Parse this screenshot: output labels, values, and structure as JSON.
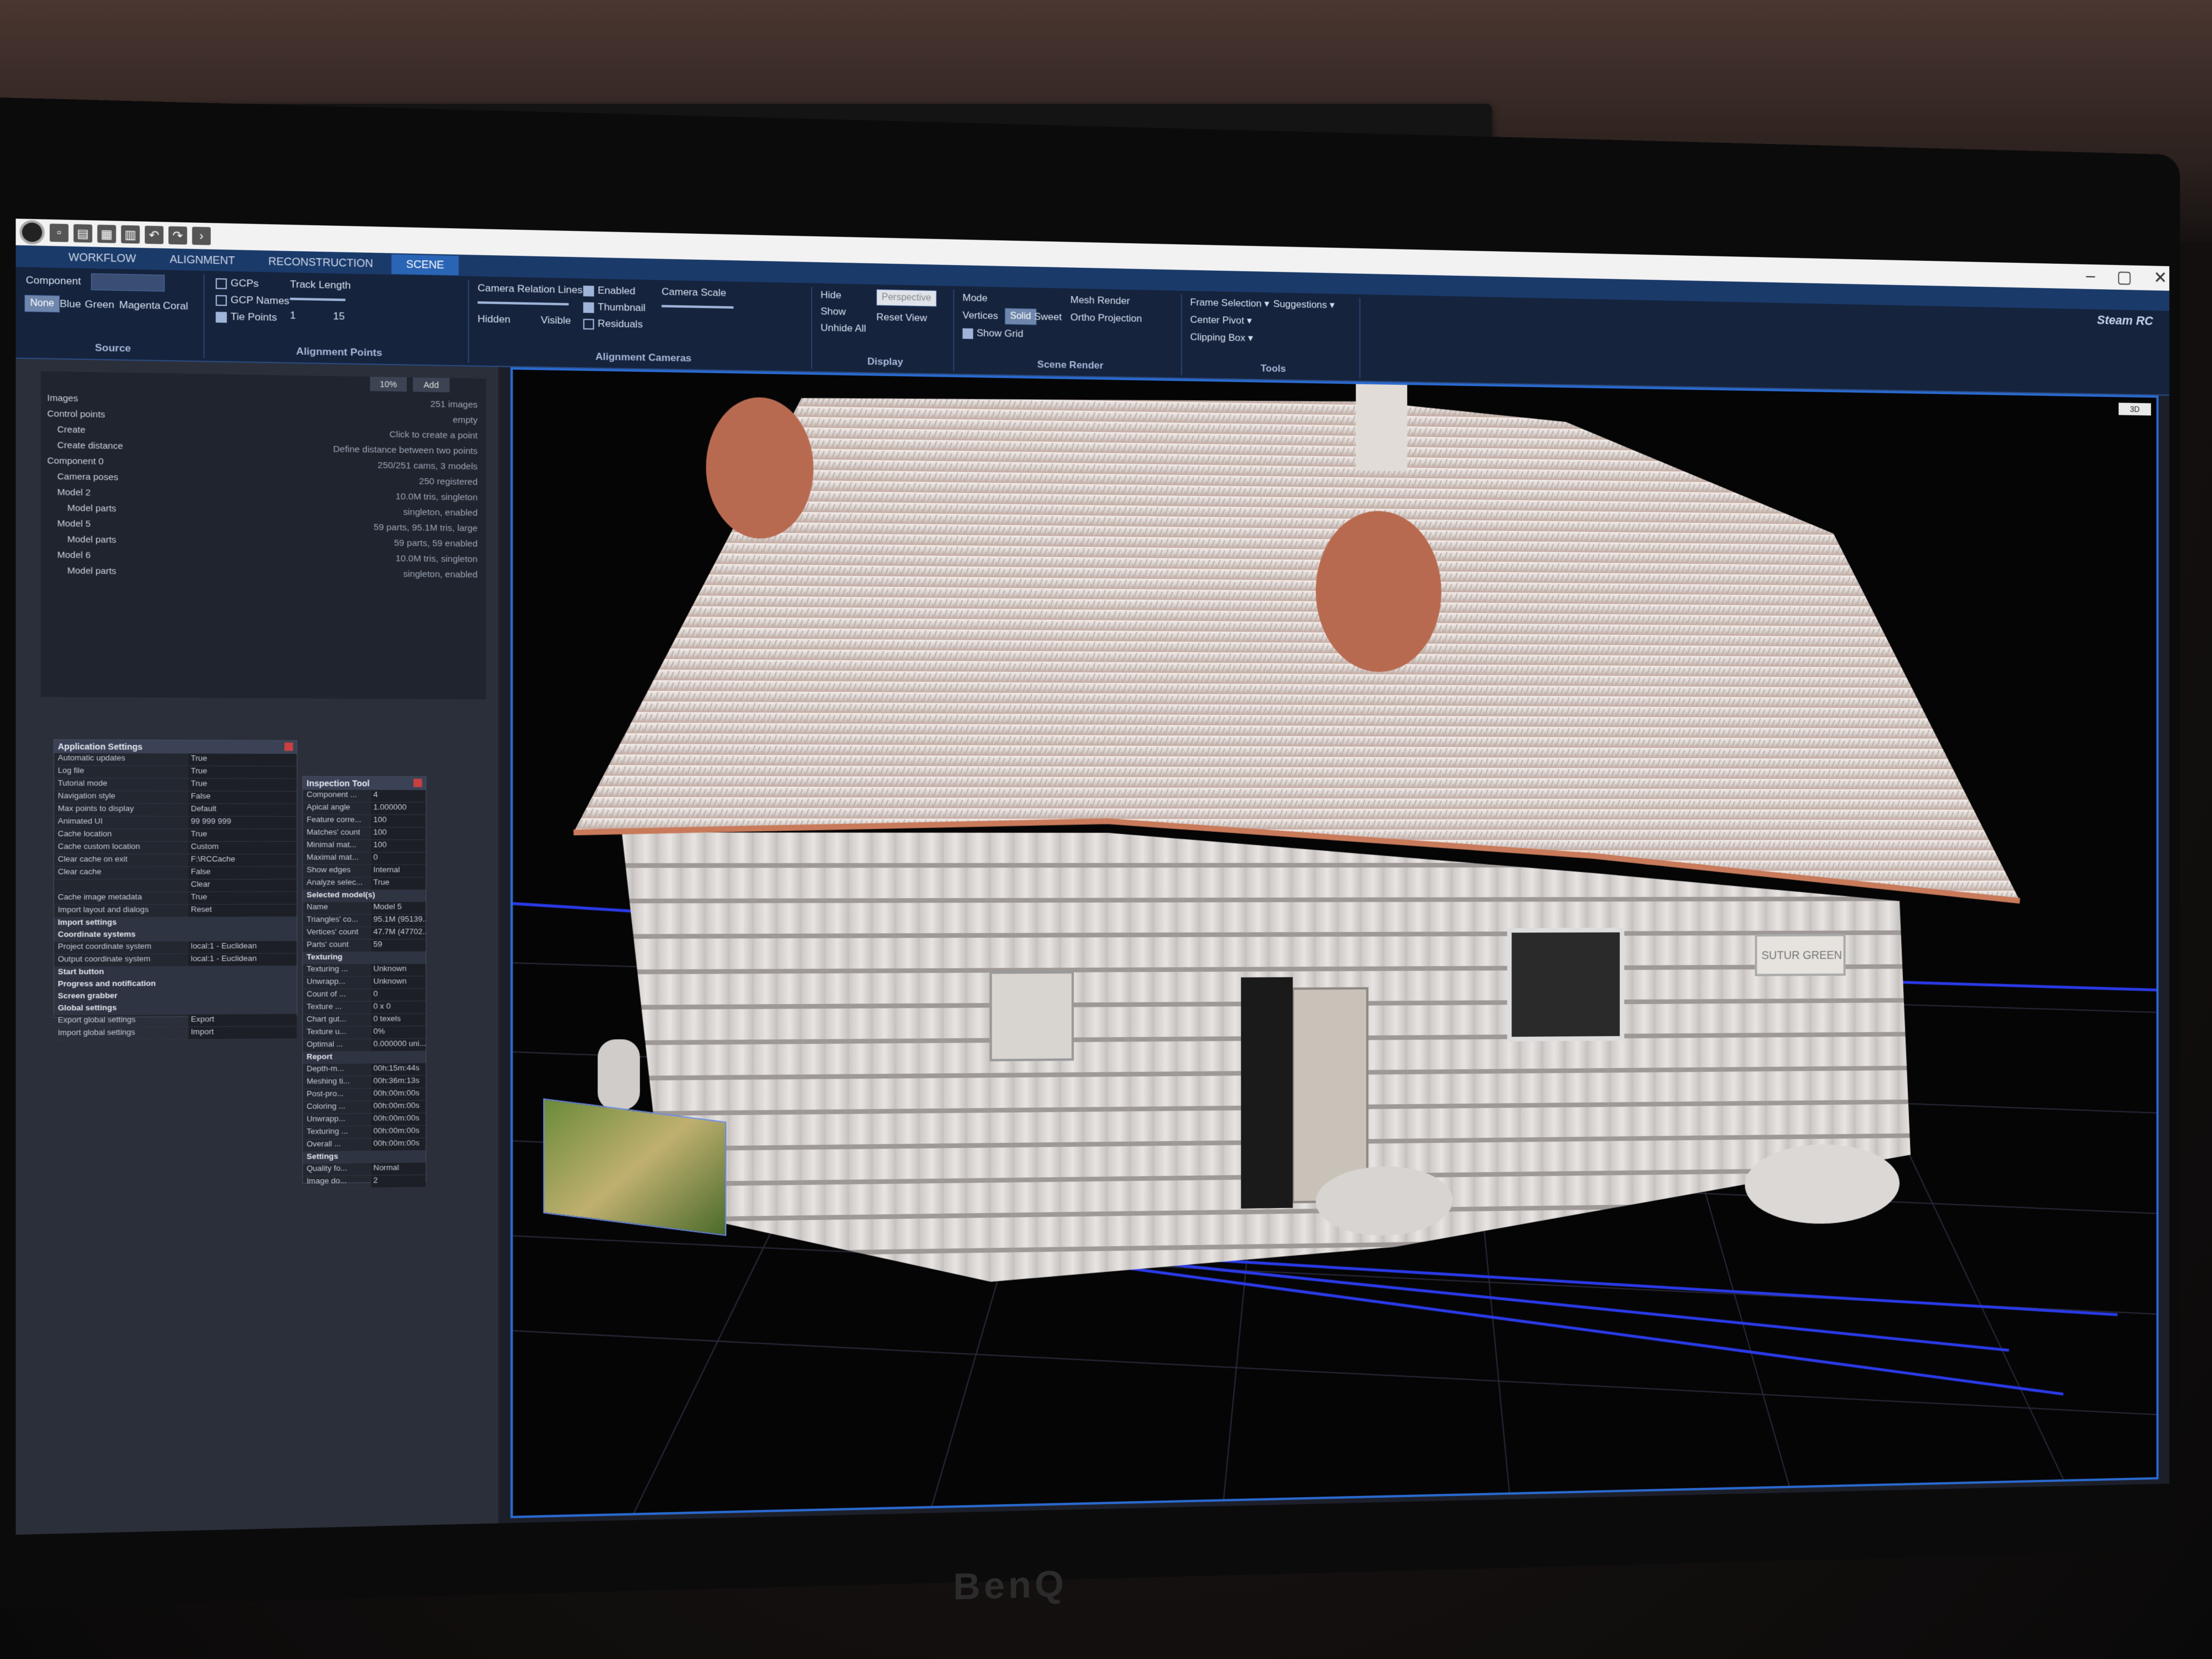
{
  "app": {
    "name": "Steam RC",
    "tabs": [
      "WORKFLOW",
      "ALIGNMENT",
      "RECONSTRUCTION",
      "SCENE"
    ],
    "active_tab": "SCENE"
  },
  "ribbon": {
    "source": {
      "label": "Source",
      "component_label": "Component",
      "colors": [
        "None",
        "Blue",
        "Green",
        "Magenta",
        "Coral"
      ]
    },
    "alignment_points": {
      "label": "Alignment Points",
      "gcps": "GCPs",
      "gcp_names": "GCP Names",
      "tie_points": "Tie Points",
      "track_length": "Track Length",
      "track_min": "1",
      "track_max": "15"
    },
    "alignment_cameras": {
      "label": "Alignment Cameras",
      "camera_relation_lines": "Camera Relation Lines",
      "hidden": "Hidden",
      "visible": "Visible",
      "enabled": "Enabled",
      "thumbnail": "Thumbnail",
      "residuals": "Residuals",
      "camera_scale": "Camera Scale"
    },
    "display": {
      "label": "Display",
      "hide": "Hide",
      "show": "Show",
      "unhide_all": "Unhide All",
      "projection": "Perspective",
      "reset_view": "Reset View"
    },
    "scene_render": {
      "label": "Scene Render",
      "mode": "Mode",
      "vertices": "Vertices",
      "solid": "Solid",
      "sweet": "Sweet",
      "show_grid": "Show Grid",
      "mesh_render": "Mesh Render",
      "ortho_projection": "Ortho Projection"
    },
    "tools": {
      "label": "Tools",
      "frame_selection": "Frame Selection",
      "suggestions": "Suggestions",
      "center_pivot": "Center Pivot",
      "clipping_box": "Clipping Box"
    }
  },
  "tree": {
    "buttons": [
      "10%",
      "Add"
    ],
    "rows": [
      {
        "key": "Images",
        "value": "251 images"
      },
      {
        "key": "Control points",
        "value": "empty"
      },
      {
        "key": "Create",
        "value": "Click to create a point"
      },
      {
        "key": "Create distance",
        "value": "Define distance between two points"
      },
      {
        "key": "Component 0",
        "value": "250/251 cams, 3 models"
      },
      {
        "key": "Camera poses",
        "value": "250 registered"
      },
      {
        "key": "Model 2",
        "value": "10.0M tris, singleton"
      },
      {
        "key": "Model parts",
        "value": "singleton, enabled"
      },
      {
        "key": "Model 5",
        "value": "59 parts, 95.1M tris, large"
      },
      {
        "key": "Model parts",
        "value": "59 parts, 59 enabled"
      },
      {
        "key": "Model 6",
        "value": "10.0M tris, singleton"
      },
      {
        "key": "Model parts",
        "value": "singleton, enabled"
      }
    ]
  },
  "settings_panel": {
    "title": "Application Settings",
    "rows": [
      {
        "k": "Automatic updates",
        "v": "True"
      },
      {
        "k": "Log file",
        "v": "True"
      },
      {
        "k": "Tutorial mode",
        "v": "True"
      },
      {
        "k": "Navigation style",
        "v": "False"
      },
      {
        "k": "Max points to display",
        "v": "Default"
      },
      {
        "k": "Animated UI",
        "v": "99 999 999"
      },
      {
        "k": "Cache location",
        "v": "True"
      },
      {
        "k": "Cache custom location",
        "v": "Custom"
      },
      {
        "k": "Clear cache on exit",
        "v": "F:\\RCCache"
      },
      {
        "k": "Clear cache",
        "v": "False"
      },
      {
        "k": "",
        "v": "Clear"
      },
      {
        "k": "Cache image metadata",
        "v": "True"
      },
      {
        "k": "Import layout and dialogs",
        "v": "Reset"
      }
    ],
    "sections": [
      "Import settings",
      "Coordinate systems"
    ],
    "coord_rows": [
      {
        "k": "Project coordinate system",
        "v": "local:1 - Euclidean"
      },
      {
        "k": "Output coordinate system",
        "v": "local:1 - Euclidean"
      }
    ],
    "sections2": [
      "Start button",
      "Progress and notification",
      "Screen grabber",
      "Global settings"
    ],
    "global_rows": [
      {
        "k": "Export global settings",
        "v": "Export"
      },
      {
        "k": "Import global settings",
        "v": "Import"
      }
    ]
  },
  "inspection_panel": {
    "title": "Inspection Tool",
    "rows": [
      {
        "k": "Component ...",
        "v": "4"
      },
      {
        "k": "Apical angle",
        "v": "1.000000"
      },
      {
        "k": "Feature corre...",
        "v": "100"
      },
      {
        "k": "Matches' count",
        "v": "100"
      },
      {
        "k": "Minimal mat...",
        "v": "100"
      },
      {
        "k": "Maximal mat...",
        "v": "0"
      },
      {
        "k": "Show edges",
        "v": "Internal"
      },
      {
        "k": "Analyze selec...",
        "v": "True"
      }
    ],
    "selected_title": "Selected model(s)",
    "selected_rows": [
      {
        "k": "Name",
        "v": "Model 5"
      },
      {
        "k": "Triangles' co...",
        "v": "95.1M (95139..."
      },
      {
        "k": "Vertices' count",
        "v": "47.7M (47702..."
      },
      {
        "k": "Parts' count",
        "v": "59"
      }
    ],
    "texturing_title": "Texturing",
    "texturing_rows": [
      {
        "k": "Texturing ...",
        "v": "Unknown"
      },
      {
        "k": "Unwrapp...",
        "v": "Unknown"
      },
      {
        "k": "Count of ...",
        "v": "0"
      },
      {
        "k": "Texture ...",
        "v": "0 x 0"
      },
      {
        "k": "Chart gut...",
        "v": "0 texels"
      },
      {
        "k": "Texture u...",
        "v": "0%"
      },
      {
        "k": "Optimal ...",
        "v": "0.000000 uni..."
      }
    ],
    "report_title": "Report",
    "report_rows": [
      {
        "k": "Depth-m...",
        "v": "00h:15m:44s"
      },
      {
        "k": "Meshing ti...",
        "v": "00h:36m:13s"
      },
      {
        "k": "Post-pro...",
        "v": "00h:00m:00s"
      },
      {
        "k": "Coloring ...",
        "v": "00h:00m:00s"
      },
      {
        "k": "Unwrapp...",
        "v": "00h:00m:00s"
      },
      {
        "k": "Texturing ...",
        "v": "00h:00m:00s"
      },
      {
        "k": "Overall ...",
        "v": "00h:00m:00s"
      }
    ],
    "settings_title": "Settings",
    "settings_rows": [
      {
        "k": "Quality fo...",
        "v": "Normal"
      },
      {
        "k": "Image do...",
        "v": "2"
      }
    ]
  },
  "viewport": {
    "mode_button": "3D",
    "sign_text": "SUTUR GREEN"
  },
  "monitor": {
    "brand": "BenQ"
  }
}
